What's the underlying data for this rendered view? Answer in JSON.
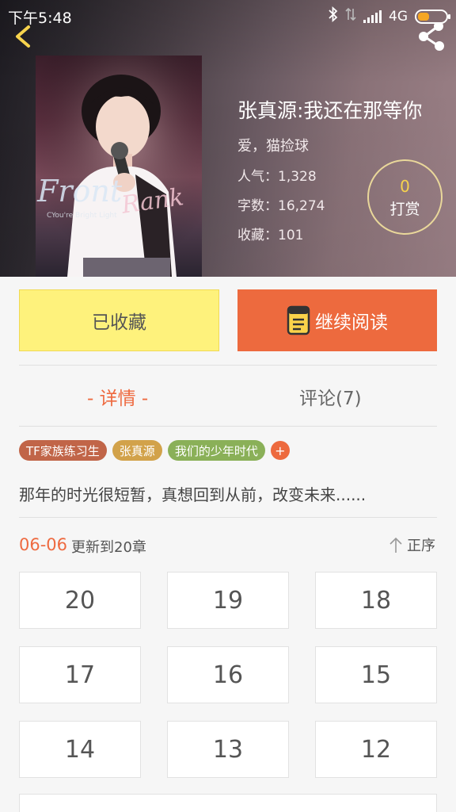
{
  "status_bar": {
    "time": "下午5:48",
    "network": "4G",
    "battery_color": "#f5a623"
  },
  "header": {
    "back_icon": "back-arrow-icon",
    "share_icon": "share-icon"
  },
  "book": {
    "title": "张真源:我还在那等你",
    "author": "爱，猫捡球",
    "popularity": "人气：1,328",
    "word_count": "字数：16,274",
    "favorites": "收藏：101",
    "cover_text": "FrontRank",
    "cover_subtext": "CYou're Bright Light"
  },
  "tip": {
    "count": "0",
    "label": "打赏"
  },
  "actions": {
    "collected_label": "已收藏",
    "continue_label": "继续阅读"
  },
  "tabs": {
    "detail": "- 详情 -",
    "comments": "评论(7)"
  },
  "tags": [
    "TF家族练习生",
    "张真源",
    "我们的少年时代"
  ],
  "tag_add": "+",
  "summary": "那年的时光很短暂，真想回到从前，改变未来......",
  "update": {
    "date": "06-06",
    "text": "更新到20章",
    "order_label": "正序"
  },
  "chapters": [
    "20",
    "19",
    "18",
    "17",
    "16",
    "15",
    "14",
    "13",
    "12"
  ],
  "colors": {
    "accent": "#ed6a3e",
    "collected_bg": "#fef27c",
    "tag_1": "#c16548",
    "tag_2": "#d2a24a",
    "tag_3": "#8ab058"
  }
}
